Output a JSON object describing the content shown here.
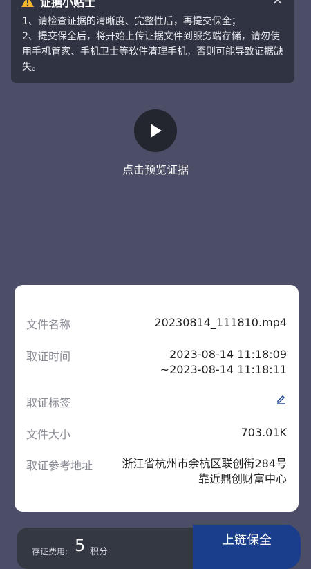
{
  "tips": {
    "title": "证据小贴士",
    "line1": "1、请检查证据的清晰度、完整性后，再提交保全；",
    "line2": "2、提交保全后，将开始上传证据文件到服务端存储，请勿使用手机管家、手机卫士等软件清理手机，否则可能导致证据缺失。"
  },
  "preview": {
    "label": "点击预览证据"
  },
  "details": {
    "file_name_label": "文件名称",
    "file_name": "20230814_111810.mp4",
    "time_label": "取证时间",
    "time_start": "2023-08-14 11:18:09",
    "time_end": "~2023-08-14 11:18:11",
    "tag_label": "取证标签",
    "size_label": "文件大小",
    "size": "703.01K",
    "address_label": "取证参考地址",
    "address_line1": "浙江省杭州市余杭区联创街284号",
    "address_line2": "靠近鼎创财富中心"
  },
  "footer": {
    "fee_label": "存证费用:",
    "fee_value": "5",
    "fee_unit": "积分",
    "submit_label": "上链保全"
  },
  "colors": {
    "background": "#4b4e66",
    "card": "#ffffff",
    "primary": "#1a3d8c"
  }
}
